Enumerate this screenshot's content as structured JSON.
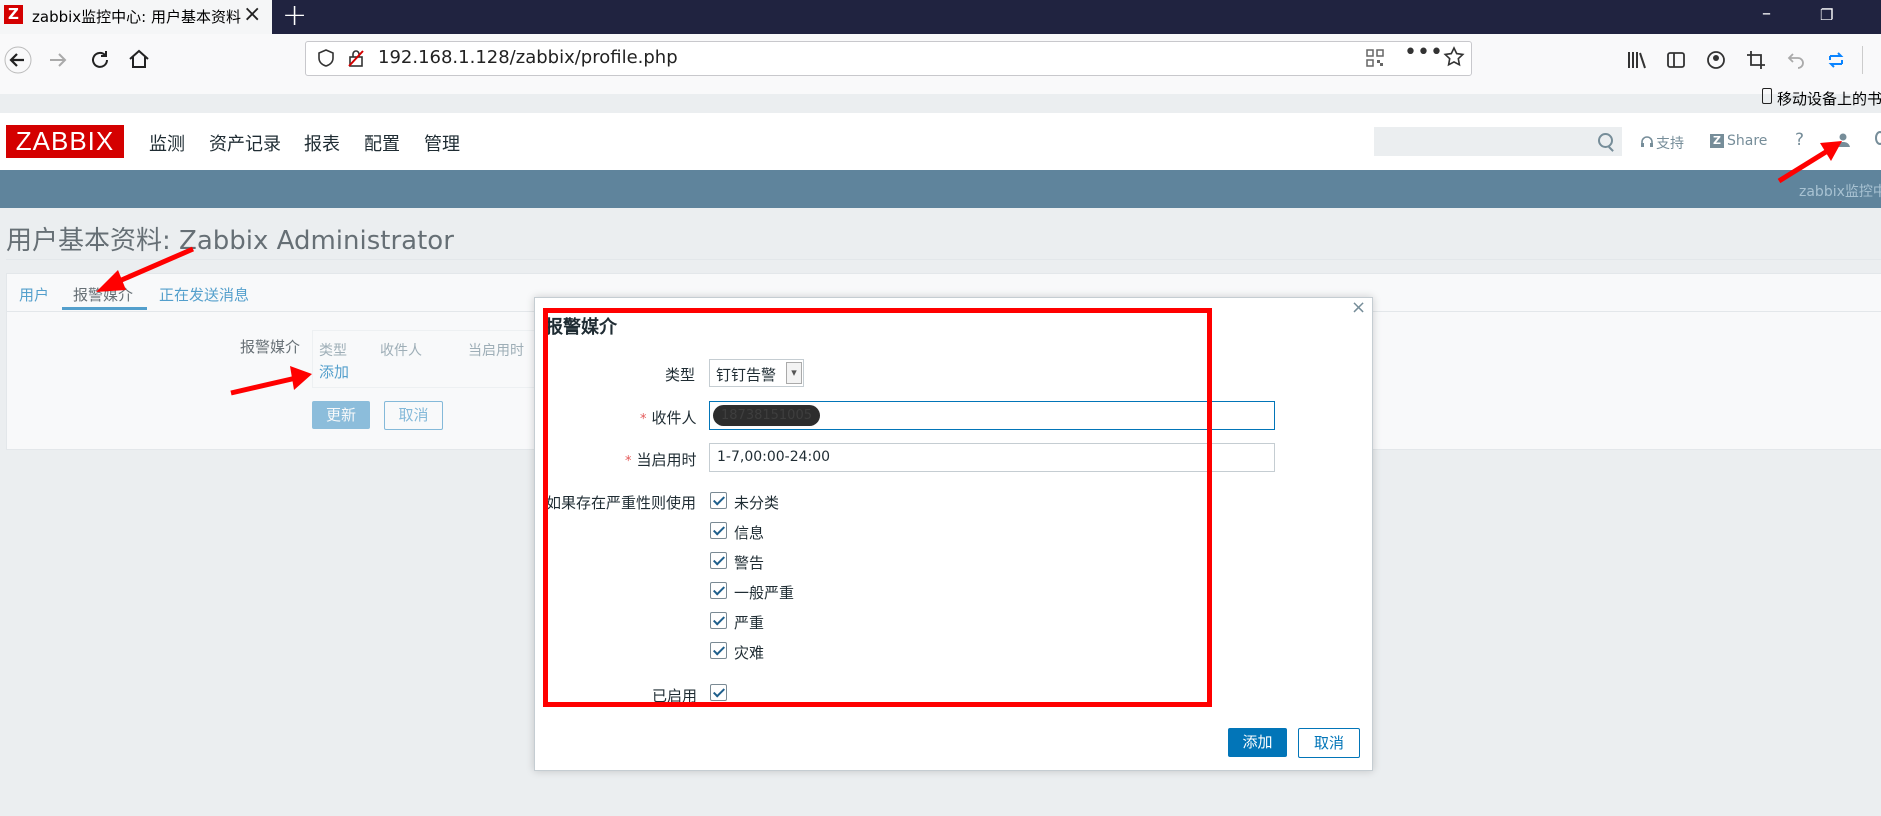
{
  "browser": {
    "tab_title": "zabbix监控中心: 用户基本资料",
    "favicon_letter": "Z",
    "url": "192.168.1.128/zabbix/profile.php",
    "bookmark_mobile": "移动设备上的书"
  },
  "zabbix": {
    "logo": "ZABBIX",
    "menu": [
      "监测",
      "资产记录",
      "报表",
      "配置",
      "管理"
    ],
    "support": "支持",
    "share": "Share",
    "help": "?",
    "band_text": "zabbix监控中"
  },
  "page": {
    "title": "用户基本资料: Zabbix Administrator",
    "tabs": [
      "用户",
      "报警媒介",
      "正在发送消息"
    ],
    "media_label": "报警媒介",
    "media_table_headers": [
      "类型",
      "收件人",
      "当启用时"
    ],
    "media_add_link": "添加",
    "update_button": "更新",
    "cancel_button": "取消"
  },
  "dialog": {
    "title": "报警媒介",
    "close": "×",
    "type_label": "类型",
    "type_value": "钉钉告警",
    "sendto_label": "收件人",
    "sendto_value": "18738151005",
    "period_label": "当启用时",
    "period_value": "1-7,00:00-24:00",
    "severity_label": "如果存在严重性则使用",
    "severities": [
      "未分类",
      "信息",
      "警告",
      "一般严重",
      "严重",
      "灾难"
    ],
    "enabled_label": "已启用",
    "add_button": "添加",
    "cancel_button": "取消"
  },
  "colors": {
    "accent": "#0275b8",
    "logo_red": "#d40000",
    "annotation_red": "#ff0000"
  }
}
